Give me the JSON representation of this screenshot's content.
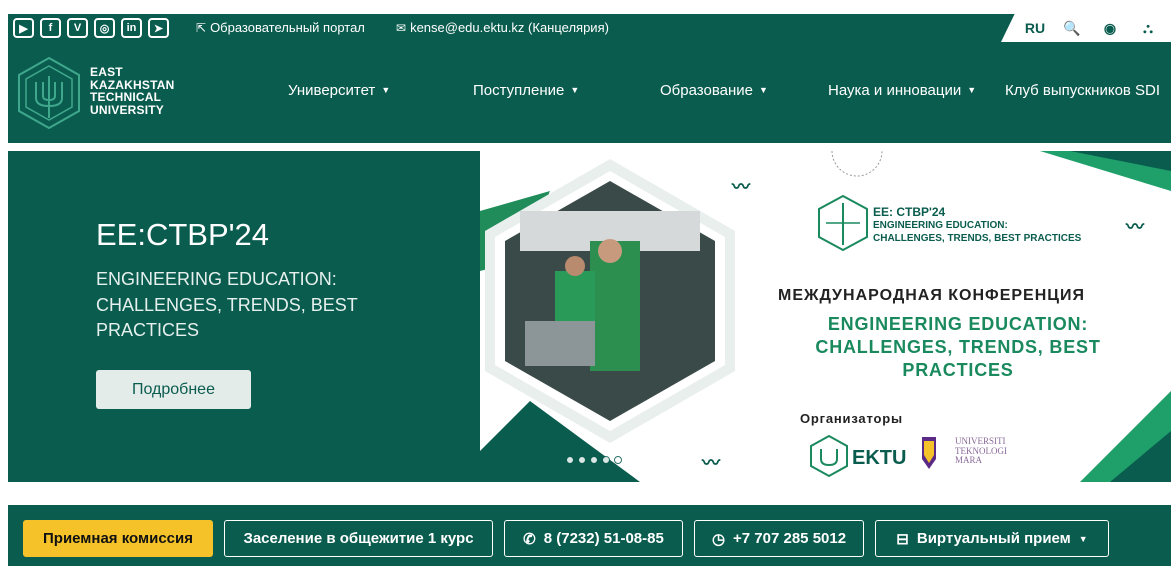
{
  "topbar": {
    "social": [
      {
        "icon": "youtube-icon",
        "glyph": "▶"
      },
      {
        "icon": "facebook-icon",
        "glyph": "f"
      },
      {
        "icon": "vk-icon",
        "glyph": "V"
      },
      {
        "icon": "instagram-icon",
        "glyph": "◎"
      },
      {
        "icon": "linkedin-icon",
        "glyph": "in"
      },
      {
        "icon": "telegram-icon",
        "glyph": "➤"
      }
    ],
    "portal_label": "Образовательный портал",
    "email_label": "kense@edu.ektu.kz (Канцелярия)",
    "lang": "RU",
    "search_glyph": "🔍",
    "eye_glyph": "◉",
    "sitemap_glyph": "⛬"
  },
  "nav": {
    "logo_lines": [
      "EAST",
      "KAZAKHSTAN",
      "TECHNICAL",
      "UNIVERSITY"
    ],
    "items": [
      "Университет",
      "Поступление",
      "Образование",
      "Наука и инновации",
      "Клуб выпускников SDI"
    ]
  },
  "hero": {
    "title": "EE:CTBP'24",
    "subtitle": "ENGINEERING EDUCATION: CHALLENGES, TRENDS, BEST PRACTICES",
    "button_label": "Подробнее"
  },
  "banner": {
    "logo_title": "EE: CTBP'24",
    "logo_sub": "ENGINEERING EDUCATION:\nCHALLENGES, TRENDS, BEST PRACTICES",
    "intl": "МЕЖДУНАРОДНАЯ КОНФЕРЕНЦИЯ",
    "main": "ENGINEERING EDUCATION: CHALLENGES, TRENDS, BEST PRACTICES",
    "organizers": "Организаторы",
    "ektu": "EKTU",
    "uitm": "UNIVERSITI\nTEKNOLOGI\nMARA",
    "slide_count": 5
  },
  "quick": {
    "admission": "Приемная комиссия",
    "dorm": "Заселение в общежитие 1 курс",
    "phone1": "8 (7232) 51-08-85",
    "phone2": "+7 707 285 5012",
    "virtual": "Виртуальный прием"
  },
  "colors": {
    "brand": "#0a5c4e",
    "accent": "#f5c329",
    "banner_green": "#1a8a5e"
  }
}
